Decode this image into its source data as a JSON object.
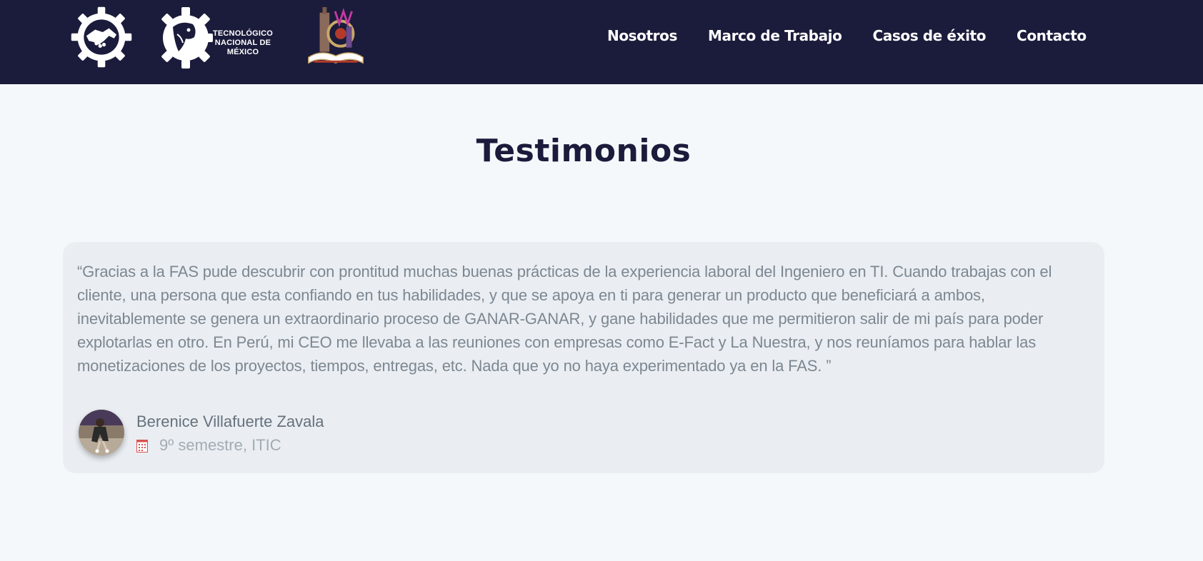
{
  "nav": {
    "logos": [
      {
        "icon": "handshake-gear-logo-icon"
      },
      {
        "icon": "tecnm-eagle-gear-logo-icon",
        "text_line1": "TECNOLÓGICO",
        "text_line2": "NACIONAL DE MÉXICO"
      },
      {
        "icon": "institution-crest-logo-icon"
      }
    ],
    "links": [
      {
        "label": "Nosotros"
      },
      {
        "label": "Marco de Trabajo"
      },
      {
        "label": "Casos de éxito"
      },
      {
        "label": "Contacto"
      }
    ]
  },
  "page": {
    "title": "Testimonios"
  },
  "testimonial": {
    "quote": "“Gracias a la FAS pude descubrir con prontitud muchas buenas prácticas de la experiencia laboral del Ingeniero en TI. Cuando trabajas con el cliente, una persona que esta confiando en tus habilidades, y que se apoya en ti para generar un producto que beneficiará a ambos, inevitablemente se genera un extraordinario proceso de GANAR-GANAR, y gane habilidades que me permitieron salir de mi país para poder explotarlas en otro. En Perú, mi CEO me llevaba a las reuniones con empresas como E-Fact y La Nuestra, y nos reuníamos para hablar las monetizaciones de los proyectos, tiempos, entregas, etc. Nada que yo no haya experimentado ya en la FAS. ”",
    "author_name": "Berenice Villafuerte Zavala",
    "author_role": "9º semestre, ITIC",
    "role_icon": "calendar-icon"
  },
  "colors": {
    "nav_background": "#1b1b3b",
    "page_background": "#f5f8fb",
    "card_background": "#eaeef2",
    "title": "#1b1b3b",
    "quote_text": "#7d8791",
    "author_name": "#66717c",
    "author_role": "#a2abb4",
    "calendar_icon": "#d9534f"
  }
}
